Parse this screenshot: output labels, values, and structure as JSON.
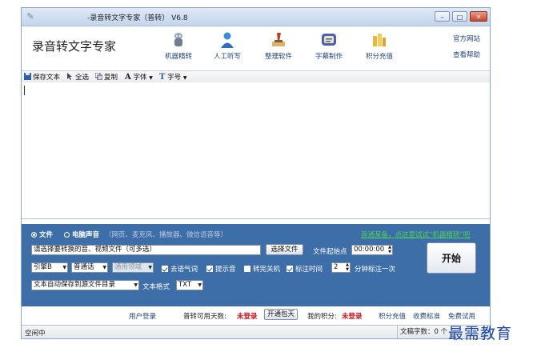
{
  "window": {
    "title": "-录音转文字专家（普转） V6.8",
    "controls": {
      "minimize": "–",
      "maximize": "□",
      "close": "✕"
    }
  },
  "header": {
    "app_name": "录音转文字专家",
    "tools": [
      {
        "label": "机器精转",
        "icon": "robot-transcribe-icon"
      },
      {
        "label": "人工听写",
        "icon": "person-dictation-icon"
      },
      {
        "label": "整理软件",
        "icon": "organize-software-icon"
      },
      {
        "label": "字幕制作",
        "icon": "subtitle-maker-icon"
      },
      {
        "label": "积分充值",
        "icon": "points-recharge-icon"
      }
    ],
    "links": {
      "official_site": "官方网站",
      "help": "查看帮助"
    }
  },
  "toolbar": {
    "save": "保存文本",
    "select_all": "全选",
    "copy": "复制",
    "font": "字体",
    "font_size": "字号"
  },
  "source": {
    "file_option": "文件",
    "computer_sound_option": "电脑声音",
    "computer_sound_hint": "（网页、麦克风、播放器、微信语音等）",
    "promo_link": "普通某备，点这里试试“机器精转”吧",
    "file_path_placeholder": "请选择要转换的音、视频文件（可多选）",
    "select_file_button": "选择文件",
    "start_point_label": "文件起始点",
    "start_point_value": "00:00:00"
  },
  "options": {
    "engine": "引擎B",
    "language": "普通话",
    "domain": "通用领域",
    "remove_filler": "去语气词",
    "beep": "提示音",
    "shutdown": "转完关机",
    "mark_time": "标注时间",
    "mark_interval": "2",
    "mark_interval_suffix": "分钟标注一次",
    "save_mode": "文本自动保存到源文件目录",
    "text_format_label": "文本格式",
    "text_format_value": "TXT",
    "start_button": "开始"
  },
  "account": {
    "user_login": "用户登录",
    "days_label": "普转可用天数:",
    "days_value": "未登录",
    "open_package": "开通包天",
    "points_label": "我的积分:",
    "points_value": "未登录",
    "recharge": "积分充值",
    "fee_standard": "收费标准",
    "free_trial": "免费试用"
  },
  "status": {
    "left": "空闲中",
    "right": "文稿字数：0 个"
  },
  "watermark": "最需教育",
  "colors": {
    "panel": "#3e6ea8",
    "accent_link": "#23457a",
    "warning_red": "#d0141c",
    "promo_green": "#49d05b"
  }
}
